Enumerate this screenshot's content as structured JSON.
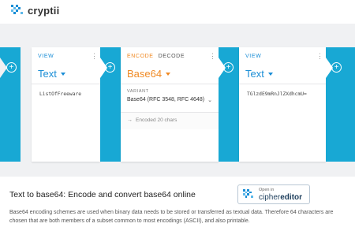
{
  "header": {
    "brand": "cryptii"
  },
  "bricks": [
    {
      "tab_active": "VIEW",
      "title": "Text",
      "content": "ListOfFreeware"
    },
    {
      "tab_active": "ENCODE",
      "tab_inactive": "DECODE",
      "title": "Base64",
      "variant_label": "VARIANT",
      "variant_value": "Base64 (RFC 3548, RFC 4648)",
      "status": "Encoded 20 chars"
    },
    {
      "tab_active": "VIEW",
      "title": "Text",
      "content": "TGlzdE9mRnJlZXdhcmU="
    }
  ],
  "info": {
    "title": "Text to base64: Encode and convert base64 online",
    "description": "Base64 encoding schemes are used when binary data needs to be stored or transferred as textual data. Therefore 64 characters are chosen that are both members of a subset common to most encodings (ASCII), and also printable.",
    "cipher_button": {
      "open_in": "Open in",
      "brand_prefix": "cipher",
      "brand_suffix": "editor"
    }
  },
  "colors": {
    "accent_blue": "#1a8ed6",
    "accent_orange": "#f08a24",
    "connector": "#18a8d4",
    "pipeline_bg": "#f0f1f3"
  },
  "icons": [
    "cryptii-logo-icon",
    "menu-dots-icon",
    "caret-down-icon",
    "plus-circle-icon",
    "arrow-right-icon",
    "chevron-down-icon",
    "cipher-editor-logo-icon"
  ]
}
